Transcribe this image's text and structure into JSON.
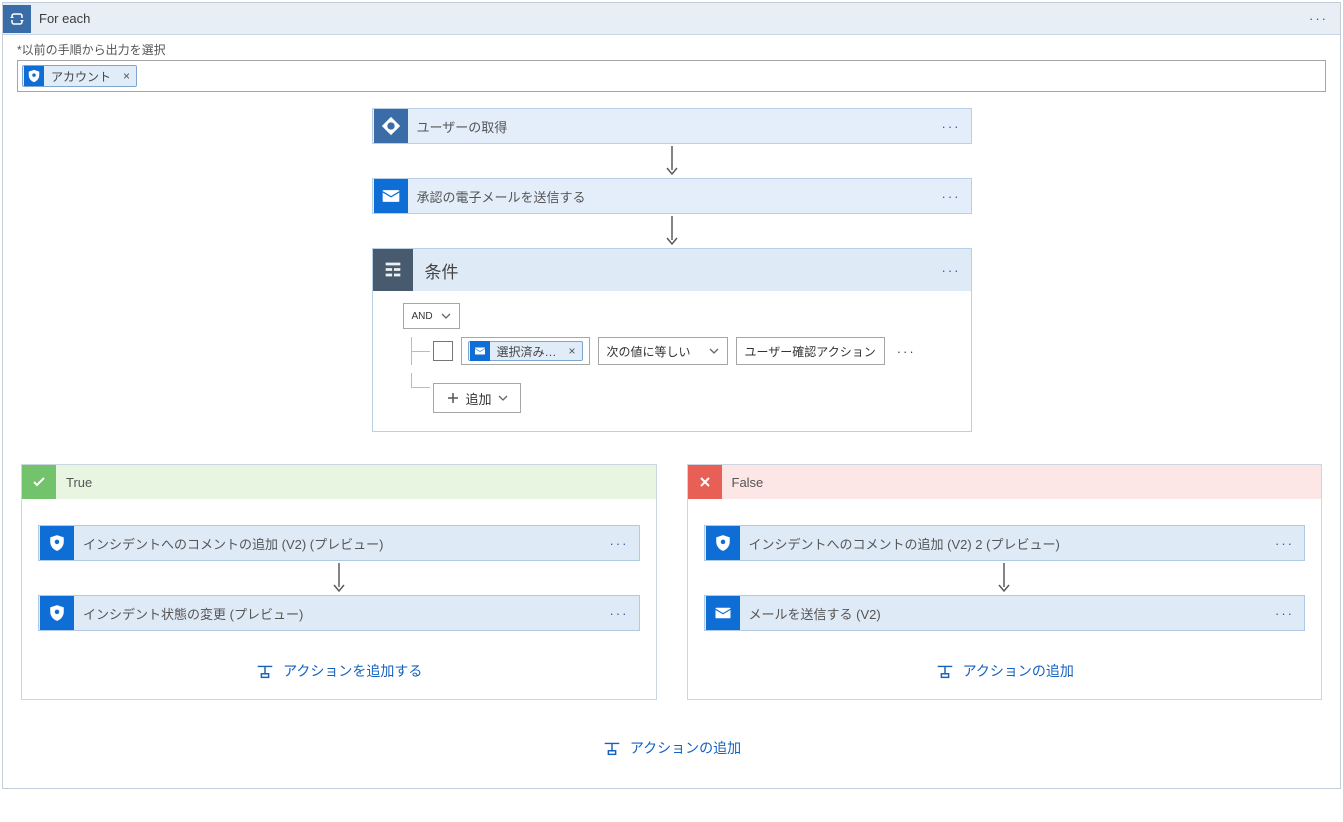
{
  "header": {
    "title": "For each"
  },
  "output_label": "*以前の手順から出力を選択",
  "token": {
    "label": "アカウント"
  },
  "actions": {
    "get_user": "ユーザーの取得",
    "send_approval": "承認の電子メールを送信する"
  },
  "condition": {
    "title": "条件",
    "and": "AND",
    "row": {
      "token_label": "選択済み…",
      "operator": "次の値に等しい",
      "value": "ユーザー確認アクション"
    },
    "add": "追加"
  },
  "branches": {
    "true": {
      "title": "True",
      "action1": "インシデントへのコメントの追加 (V2) (プレビュー)",
      "action2": "インシデント状態の変更 (プレビュー)",
      "add_link": "アクションを追加する"
    },
    "false": {
      "title": "False",
      "action1": "インシデントへのコメントの追加 (V2) 2 (プレビュー)",
      "action2": "メールを送信する (V2)",
      "add_link": "アクションの追加"
    }
  },
  "outer_add_link": "アクションの追加"
}
